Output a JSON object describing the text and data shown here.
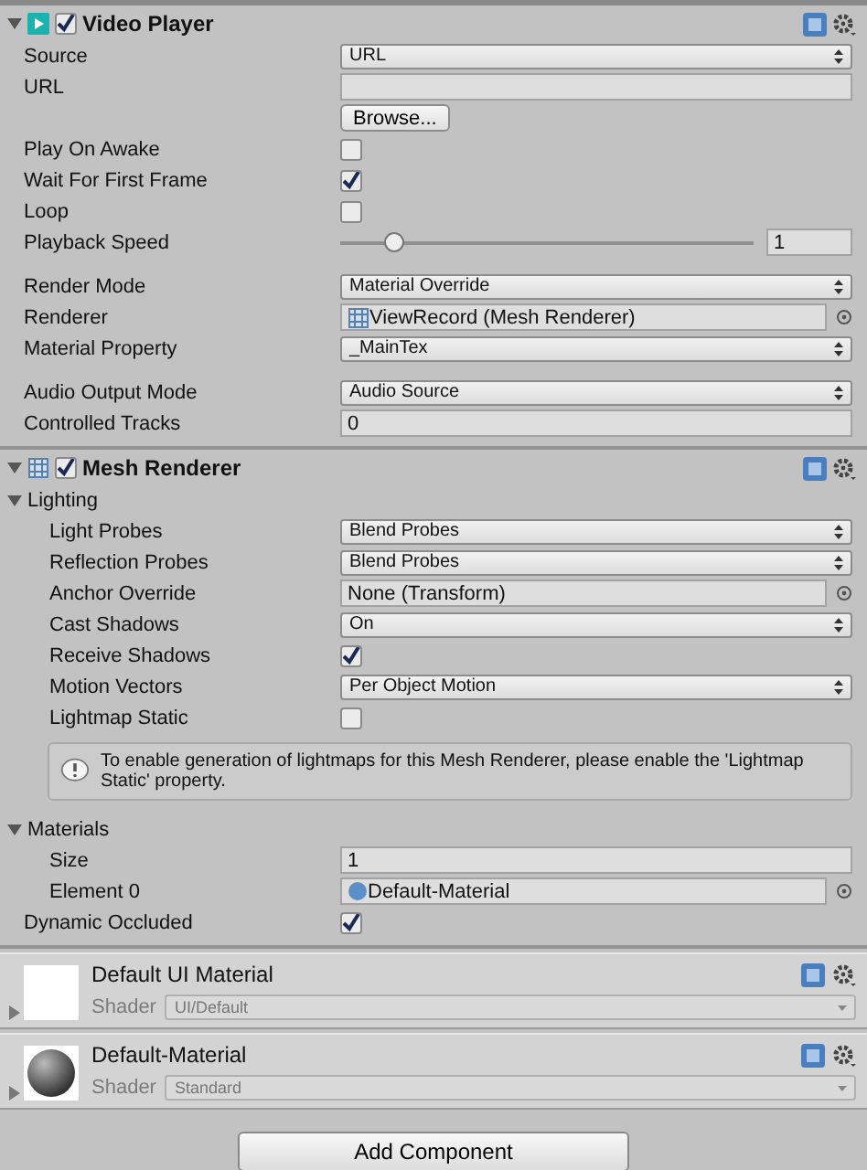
{
  "components": [
    {
      "title": "Video Player",
      "kind": "video",
      "enabled": true,
      "expanded": true,
      "rows": [
        {
          "kind": "dropdown",
          "label": "Source",
          "value": "URL"
        },
        {
          "kind": "text",
          "label": "URL"
        },
        {
          "kind": "button",
          "value": "Browse..."
        },
        {
          "kind": "checkbox",
          "label": "Play On Awake",
          "checked": false
        },
        {
          "kind": "checkbox",
          "label": "Wait For First Frame",
          "checked": true
        },
        {
          "kind": "checkbox",
          "label": "Loop",
          "checked": false
        },
        {
          "kind": "slider",
          "label": "Playback Speed",
          "level": 0.11,
          "value": "1"
        },
        {
          "kind": "gap"
        },
        {
          "kind": "dropdown",
          "label": "Render Mode",
          "value": "Material Override"
        },
        {
          "kind": "meshref",
          "label": "Renderer",
          "value": "ViewRecord (Mesh Renderer)"
        },
        {
          "kind": "dropdown",
          "label": "Material Property",
          "value": "_MainTex"
        },
        {
          "kind": "gap"
        },
        {
          "kind": "dropdown",
          "label": "Audio Output Mode",
          "value": "Audio Source"
        },
        {
          "kind": "text",
          "label": "Controlled Tracks",
          "value": "0"
        }
      ]
    },
    {
      "title": "Mesh Renderer",
      "kind": "mesh",
      "enabled": true,
      "expanded": true,
      "rows": [
        {
          "kind": "foldout",
          "label": "Lighting",
          "expanded": true,
          "children": [
            {
              "kind": "dropdown",
              "label": "Light Probes",
              "value": "Blend Probes"
            },
            {
              "kind": "dropdown",
              "label": "Reflection Probes",
              "value": "Blend Probes"
            },
            {
              "kind": "object",
              "label": "Anchor Override",
              "value": "None (Transform)"
            },
            {
              "kind": "dropdown",
              "label": "Cast Shadows",
              "value": "On"
            },
            {
              "kind": "checkbox",
              "label": "Receive Shadows",
              "checked": true
            },
            {
              "kind": "dropdown",
              "label": "Motion Vectors",
              "value": "Per Object Motion"
            },
            {
              "kind": "checkbox",
              "label": "Lightmap Static",
              "checked": false
            }
          ]
        },
        {
          "kind": "help",
          "text": "To enable generation of lightmaps for this Mesh Renderer, please enable the 'Lightmap Static' property."
        },
        {
          "kind": "foldout",
          "label": "Materials",
          "expanded": true,
          "children": [
            {
              "kind": "text",
              "label": "Size",
              "value": "1"
            },
            {
              "kind": "materialref",
              "label": "Element 0",
              "value": "Default-Material"
            }
          ]
        },
        {
          "kind": "checkbox",
          "label": "Dynamic Occluded",
          "checked": true
        }
      ]
    }
  ],
  "materials": [
    {
      "name": "Default UI Material",
      "kind": "flat",
      "shader_label": "Shader",
      "shader": "UI/Default"
    },
    {
      "name": "Default-Material",
      "kind": "sphere",
      "shader_label": "Shader",
      "shader": "Standard"
    }
  ],
  "add_button": "Add Component"
}
